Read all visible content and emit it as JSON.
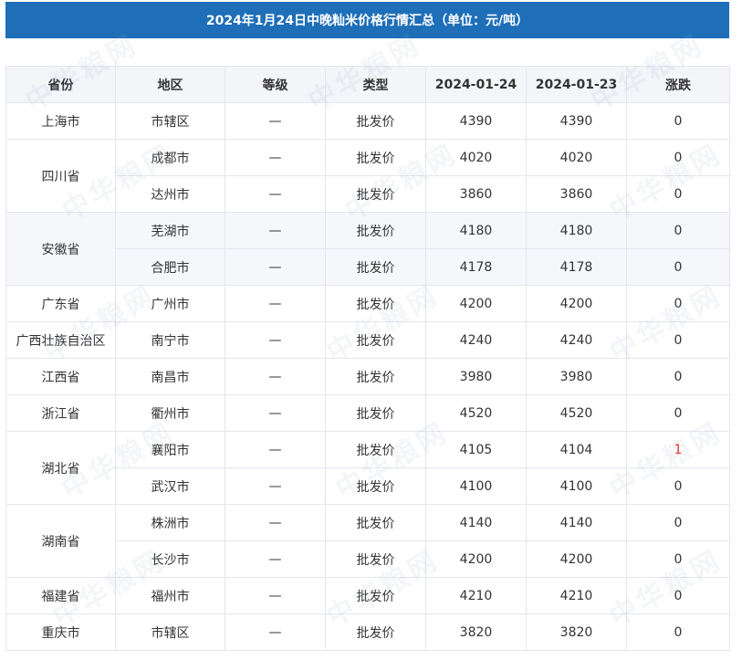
{
  "title": "2024年1月24日中晚籼米价格行情汇总（单位：元/吨）",
  "watermark": "中华粮网",
  "colors": {
    "header_bar": "#1e6eb8",
    "rise": "#e62b2b"
  },
  "table": {
    "headers": [
      "省份",
      "地区",
      "等级",
      "类型",
      "2024-01-24",
      "2024-01-23",
      "涨跌"
    ],
    "groups": [
      {
        "province": "上海市",
        "rows": [
          {
            "region": "市辖区",
            "grade": "—",
            "type": "批发价",
            "price_today": "4390",
            "price_prev": "4390",
            "change": "0"
          }
        ]
      },
      {
        "province": "四川省",
        "rows": [
          {
            "region": "成都市",
            "grade": "—",
            "type": "批发价",
            "price_today": "4020",
            "price_prev": "4020",
            "change": "0"
          },
          {
            "region": "达州市",
            "grade": "—",
            "type": "批发价",
            "price_today": "3860",
            "price_prev": "3860",
            "change": "0"
          }
        ]
      },
      {
        "province": "安徽省",
        "rows": [
          {
            "region": "芜湖市",
            "grade": "—",
            "type": "批发价",
            "price_today": "4180",
            "price_prev": "4180",
            "change": "0"
          },
          {
            "region": "合肥市",
            "grade": "—",
            "type": "批发价",
            "price_today": "4178",
            "price_prev": "4178",
            "change": "0"
          }
        ]
      },
      {
        "province": "广东省",
        "rows": [
          {
            "region": "广州市",
            "grade": "—",
            "type": "批发价",
            "price_today": "4200",
            "price_prev": "4200",
            "change": "0"
          }
        ]
      },
      {
        "province": "广西壮族自治区",
        "rows": [
          {
            "region": "南宁市",
            "grade": "—",
            "type": "批发价",
            "price_today": "4240",
            "price_prev": "4240",
            "change": "0"
          }
        ]
      },
      {
        "province": "江西省",
        "rows": [
          {
            "region": "南昌市",
            "grade": "—",
            "type": "批发价",
            "price_today": "3980",
            "price_prev": "3980",
            "change": "0"
          }
        ]
      },
      {
        "province": "浙江省",
        "rows": [
          {
            "region": "衢州市",
            "grade": "—",
            "type": "批发价",
            "price_today": "4520",
            "price_prev": "4520",
            "change": "0"
          }
        ]
      },
      {
        "province": "湖北省",
        "rows": [
          {
            "region": "襄阳市",
            "grade": "—",
            "type": "批发价",
            "price_today": "4105",
            "price_prev": "4104",
            "change": "1"
          },
          {
            "region": "武汉市",
            "grade": "—",
            "type": "批发价",
            "price_today": "4100",
            "price_prev": "4100",
            "change": "0"
          }
        ]
      },
      {
        "province": "湖南省",
        "rows": [
          {
            "region": "株洲市",
            "grade": "—",
            "type": "批发价",
            "price_today": "4140",
            "price_prev": "4140",
            "change": "0"
          },
          {
            "region": "长沙市",
            "grade": "—",
            "type": "批发价",
            "price_today": "4200",
            "price_prev": "4200",
            "change": "0"
          }
        ]
      },
      {
        "province": "福建省",
        "rows": [
          {
            "region": "福州市",
            "grade": "—",
            "type": "批发价",
            "price_today": "4210",
            "price_prev": "4210",
            "change": "0"
          }
        ]
      },
      {
        "province": "重庆市",
        "rows": [
          {
            "region": "市辖区",
            "grade": "—",
            "type": "批发价",
            "price_today": "3820",
            "price_prev": "3820",
            "change": "0"
          }
        ]
      }
    ]
  }
}
